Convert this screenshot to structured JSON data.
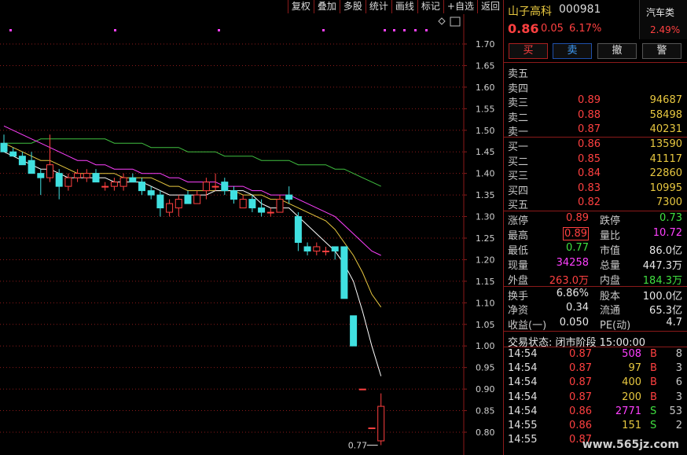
{
  "toolbar": [
    {
      "label": "复权"
    },
    {
      "label": "叠加"
    },
    {
      "label": "多股"
    },
    {
      "label": "统计"
    },
    {
      "label": "画线"
    },
    {
      "label": "标记"
    },
    {
      "label": "+自选"
    },
    {
      "label": "返回"
    }
  ],
  "stock": {
    "name": "山子高科",
    "code": "000981",
    "price": "0.86",
    "change": "0.05",
    "pct": "6.17%",
    "industry": "汽车类",
    "industry_pct": "2.49%"
  },
  "trade_buttons": {
    "buy": "买",
    "sell": "卖",
    "cancel": "撤",
    "alert": "警"
  },
  "order_book": {
    "asks": [
      {
        "label": "卖五",
        "price": "",
        "vol": ""
      },
      {
        "label": "卖四",
        "price": "",
        "vol": ""
      },
      {
        "label": "卖三",
        "price": "0.89",
        "vol": "94687"
      },
      {
        "label": "卖二",
        "price": "0.88",
        "vol": "58498"
      },
      {
        "label": "卖一",
        "price": "0.87",
        "vol": "40231"
      }
    ],
    "bids": [
      {
        "label": "买一",
        "price": "0.86",
        "vol": "13590"
      },
      {
        "label": "买二",
        "price": "0.85",
        "vol": "41117"
      },
      {
        "label": "买三",
        "price": "0.84",
        "vol": "22860"
      },
      {
        "label": "买四",
        "price": "0.83",
        "vol": "10995"
      },
      {
        "label": "买五",
        "price": "0.82",
        "vol": "7300"
      }
    ]
  },
  "stats": [
    {
      "l1": "涨停",
      "v1": "0.89",
      "l2": "跌停",
      "v2": "0.73"
    },
    {
      "l1": "最高",
      "v1": "0.89",
      "l2": "量比",
      "v2": "10.72"
    },
    {
      "l1": "最低",
      "v1": "0.77",
      "l2": "市值",
      "v2": "86.0亿"
    },
    {
      "l1": "现量",
      "v1": "34258",
      "l2": "总量",
      "v2": "447.3万"
    },
    {
      "l1": "外盘",
      "v1": "263.0万",
      "l2": "内盘",
      "v2": "184.3万"
    },
    {
      "l1": "换手",
      "v1": "6.86%",
      "l2": "股本",
      "v2": "100.0亿"
    },
    {
      "l1": "净资",
      "v1": "0.34",
      "l2": "流通",
      "v2": "65.3亿"
    },
    {
      "l1": "收益(一)",
      "v1": "0.050",
      "l2": "PE(动)",
      "v2": "4.7"
    }
  ],
  "status_line": "交易状态: 闭市阶段 15:00:00",
  "ticks": [
    {
      "time": "14:54",
      "price": "0.87",
      "vol": "508",
      "bs": "B",
      "n": "8"
    },
    {
      "time": "14:54",
      "price": "0.87",
      "vol": "97",
      "bs": "B",
      "n": "3"
    },
    {
      "time": "14:54",
      "price": "0.87",
      "vol": "400",
      "bs": "B",
      "n": "6"
    },
    {
      "time": "14:54",
      "price": "0.87",
      "vol": "200",
      "bs": "B",
      "n": "3"
    },
    {
      "time": "14:54",
      "price": "0.86",
      "vol": "2771",
      "bs": "S",
      "n": "53"
    },
    {
      "time": "14:55",
      "price": "0.86",
      "vol": "151",
      "bs": "S",
      "n": "2"
    },
    {
      "time": "14:55",
      "price": "0.87",
      "vol": "",
      "bs": "",
      "n": ""
    }
  ],
  "watermark": "www.565jz.com",
  "colors": {
    "up": "#ff4040",
    "down": "#40e0e0",
    "ma5": "#ffffff",
    "ma10": "#e8c840",
    "ma20": "#ff40ff",
    "ma60": "#40c040",
    "grid": "#8b1a1a"
  },
  "chart_data": {
    "type": "candlestick",
    "y_ticks": [
      "1.70",
      "1.65",
      "1.60",
      "1.55",
      "1.50",
      "1.45",
      "1.40",
      "1.35",
      "1.30",
      "1.25",
      "1.20",
      "1.15",
      "1.10",
      "1.05",
      "1.00",
      "0.95",
      "0.90",
      "0.85",
      "0.80"
    ],
    "ylim": [
      0.77,
      1.73
    ],
    "low_marker": "0.77",
    "candles": [
      {
        "o": 1.47,
        "h": 1.49,
        "l": 1.45,
        "c": 1.45
      },
      {
        "o": 1.45,
        "h": 1.46,
        "l": 1.44,
        "c": 1.44
      },
      {
        "o": 1.44,
        "h": 1.45,
        "l": 1.42,
        "c": 1.42
      },
      {
        "o": 1.43,
        "h": 1.45,
        "l": 1.4,
        "c": 1.4
      },
      {
        "o": 1.4,
        "h": 1.41,
        "l": 1.35,
        "c": 1.39
      },
      {
        "o": 1.39,
        "h": 1.49,
        "l": 1.38,
        "c": 1.42
      },
      {
        "o": 1.4,
        "h": 1.41,
        "l": 1.34,
        "c": 1.37
      },
      {
        "o": 1.37,
        "h": 1.4,
        "l": 1.36,
        "c": 1.39
      },
      {
        "o": 1.39,
        "h": 1.41,
        "l": 1.38,
        "c": 1.4
      },
      {
        "o": 1.39,
        "h": 1.41,
        "l": 1.38,
        "c": 1.4
      },
      {
        "o": 1.4,
        "h": 1.41,
        "l": 1.38,
        "c": 1.38
      },
      {
        "o": 1.37,
        "h": 1.38,
        "l": 1.36,
        "c": 1.37
      },
      {
        "o": 1.37,
        "h": 1.39,
        "l": 1.36,
        "c": 1.38
      },
      {
        "o": 1.37,
        "h": 1.4,
        "l": 1.36,
        "c": 1.39
      },
      {
        "o": 1.39,
        "h": 1.4,
        "l": 1.38,
        "c": 1.38
      },
      {
        "o": 1.38,
        "h": 1.39,
        "l": 1.35,
        "c": 1.36
      },
      {
        "o": 1.36,
        "h": 1.37,
        "l": 1.34,
        "c": 1.35
      },
      {
        "o": 1.35,
        "h": 1.36,
        "l": 1.3,
        "c": 1.32
      },
      {
        "o": 1.31,
        "h": 1.34,
        "l": 1.3,
        "c": 1.33
      },
      {
        "o": 1.32,
        "h": 1.35,
        "l": 1.3,
        "c": 1.34
      },
      {
        "o": 1.35,
        "h": 1.36,
        "l": 1.33,
        "c": 1.33
      },
      {
        "o": 1.33,
        "h": 1.36,
        "l": 1.33,
        "c": 1.35
      },
      {
        "o": 1.36,
        "h": 1.39,
        "l": 1.34,
        "c": 1.38
      },
      {
        "o": 1.37,
        "h": 1.4,
        "l": 1.36,
        "c": 1.37
      },
      {
        "o": 1.38,
        "h": 1.39,
        "l": 1.35,
        "c": 1.36
      },
      {
        "o": 1.36,
        "h": 1.37,
        "l": 1.33,
        "c": 1.34
      },
      {
        "o": 1.32,
        "h": 1.35,
        "l": 1.32,
        "c": 1.34
      },
      {
        "o": 1.34,
        "h": 1.35,
        "l": 1.31,
        "c": 1.32
      },
      {
        "o": 1.32,
        "h": 1.34,
        "l": 1.3,
        "c": 1.31
      },
      {
        "o": 1.31,
        "h": 1.32,
        "l": 1.3,
        "c": 1.31
      },
      {
        "o": 1.31,
        "h": 1.35,
        "l": 1.31,
        "c": 1.34
      },
      {
        "o": 1.35,
        "h": 1.37,
        "l": 1.33,
        "c": 1.34
      },
      {
        "o": 1.3,
        "h": 1.31,
        "l": 1.22,
        "c": 1.24
      },
      {
        "o": 1.23,
        "h": 1.24,
        "l": 1.21,
        "c": 1.22
      },
      {
        "o": 1.22,
        "h": 1.24,
        "l": 1.21,
        "c": 1.23
      },
      {
        "o": 1.22,
        "h": 1.23,
        "l": 1.21,
        "c": 1.22
      },
      {
        "o": 1.23,
        "h": 1.23,
        "l": 1.2,
        "c": 1.22
      },
      {
        "o": 1.23,
        "h": 1.23,
        "l": 1.11,
        "c": 1.11
      },
      {
        "o": 1.07,
        "h": 1.07,
        "l": 1.0,
        "c": 1.0
      },
      {
        "o": 0.9,
        "h": 0.9,
        "l": 0.9,
        "c": 0.9
      },
      {
        "o": 0.81,
        "h": 0.81,
        "l": 0.81,
        "c": 0.81
      },
      {
        "o": 0.78,
        "h": 0.89,
        "l": 0.77,
        "c": 0.86
      }
    ],
    "ma5": [
      1.45,
      1.44,
      1.43,
      1.42,
      1.41,
      1.41,
      1.4,
      1.39,
      1.39,
      1.39,
      1.39,
      1.39,
      1.38,
      1.38,
      1.38,
      1.38,
      1.37,
      1.36,
      1.35,
      1.35,
      1.35,
      1.35,
      1.35,
      1.36,
      1.36,
      1.36,
      1.36,
      1.35,
      1.33,
      1.32,
      1.32,
      1.32,
      1.3,
      1.28,
      1.26,
      1.24,
      1.22,
      1.19,
      1.15,
      1.08,
      1.0,
      0.93
    ],
    "ma10": [
      1.47,
      1.46,
      1.45,
      1.44,
      1.43,
      1.43,
      1.42,
      1.41,
      1.4,
      1.4,
      1.4,
      1.4,
      1.4,
      1.39,
      1.39,
      1.39,
      1.39,
      1.38,
      1.37,
      1.37,
      1.36,
      1.36,
      1.36,
      1.36,
      1.36,
      1.36,
      1.35,
      1.35,
      1.35,
      1.34,
      1.34,
      1.33,
      1.32,
      1.31,
      1.3,
      1.29,
      1.27,
      1.24,
      1.21,
      1.17,
      1.12,
      1.09
    ],
    "ma20": [
      1.51,
      1.5,
      1.49,
      1.48,
      1.47,
      1.46,
      1.45,
      1.44,
      1.43,
      1.43,
      1.42,
      1.42,
      1.41,
      1.41,
      1.41,
      1.4,
      1.4,
      1.4,
      1.39,
      1.39,
      1.38,
      1.38,
      1.38,
      1.38,
      1.37,
      1.37,
      1.37,
      1.36,
      1.36,
      1.35,
      1.35,
      1.35,
      1.34,
      1.33,
      1.32,
      1.31,
      1.3,
      1.28,
      1.26,
      1.24,
      1.22,
      1.21
    ],
    "ma60": [
      1.47,
      1.47,
      1.47,
      1.47,
      1.48,
      1.48,
      1.48,
      1.48,
      1.48,
      1.48,
      1.48,
      1.48,
      1.47,
      1.47,
      1.47,
      1.47,
      1.46,
      1.46,
      1.46,
      1.46,
      1.45,
      1.45,
      1.45,
      1.45,
      1.44,
      1.44,
      1.44,
      1.44,
      1.43,
      1.43,
      1.43,
      1.43,
      1.42,
      1.42,
      1.42,
      1.42,
      1.41,
      1.41,
      1.4,
      1.39,
      1.38,
      1.37
    ]
  }
}
